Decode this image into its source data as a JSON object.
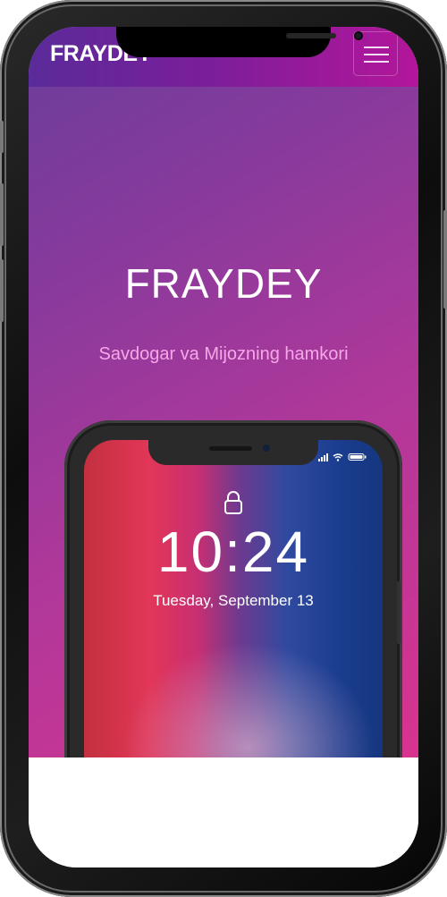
{
  "header": {
    "brand": "FRAYDEY",
    "menu_icon": "hamburger-icon"
  },
  "hero": {
    "title": "FRAYDEY",
    "subtitle": "Savdogar va Mijozning hamkori"
  },
  "mockup": {
    "time": "10:24",
    "date": "Tuesday, September 13",
    "lock_icon": "lock-icon",
    "status_icons": [
      "signal-icon",
      "wifi-icon",
      "battery-icon"
    ]
  },
  "colors": {
    "gradient_start": "#6a3d9a",
    "gradient_end": "#d9338f",
    "subtitle": "#f5a8e8"
  }
}
